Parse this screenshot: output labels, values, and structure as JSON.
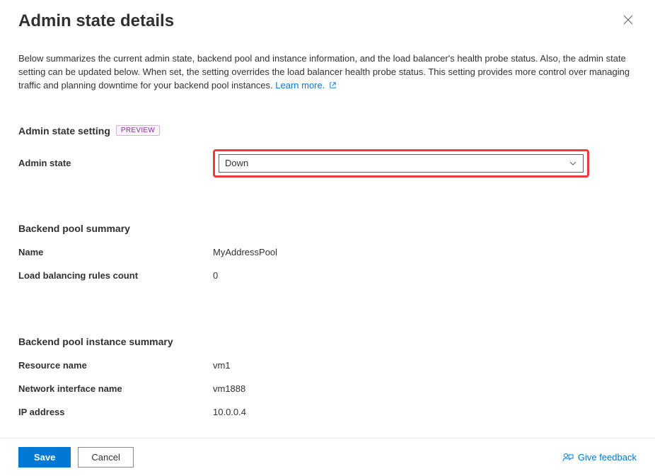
{
  "header": {
    "title": "Admin state details"
  },
  "description": {
    "text": "Below summarizes the current admin state, backend pool and instance information, and the load balancer's health probe status. Also, the admin state setting can be updated below. When set, the setting overrides the load balancer health probe status. This setting provides more control over managing traffic and planning downtime for your backend pool instances. ",
    "learn_more_label": "Learn more."
  },
  "admin_state_setting": {
    "section_title": "Admin state setting",
    "badge": "PREVIEW",
    "field_label": "Admin state",
    "selected_value": "Down"
  },
  "backend_pool_summary": {
    "section_title": "Backend pool summary",
    "name_label": "Name",
    "name_value": "MyAddressPool",
    "rules_count_label": "Load balancing rules count",
    "rules_count_value": "0"
  },
  "backend_pool_instance_summary": {
    "section_title": "Backend pool instance summary",
    "resource_name_label": "Resource name",
    "resource_name_value": "vm1",
    "nic_name_label": "Network interface name",
    "nic_name_value": "vm1888",
    "ip_label": "IP address",
    "ip_value": "10.0.0.4"
  },
  "footer": {
    "save_label": "Save",
    "cancel_label": "Cancel",
    "feedback_label": "Give feedback"
  }
}
